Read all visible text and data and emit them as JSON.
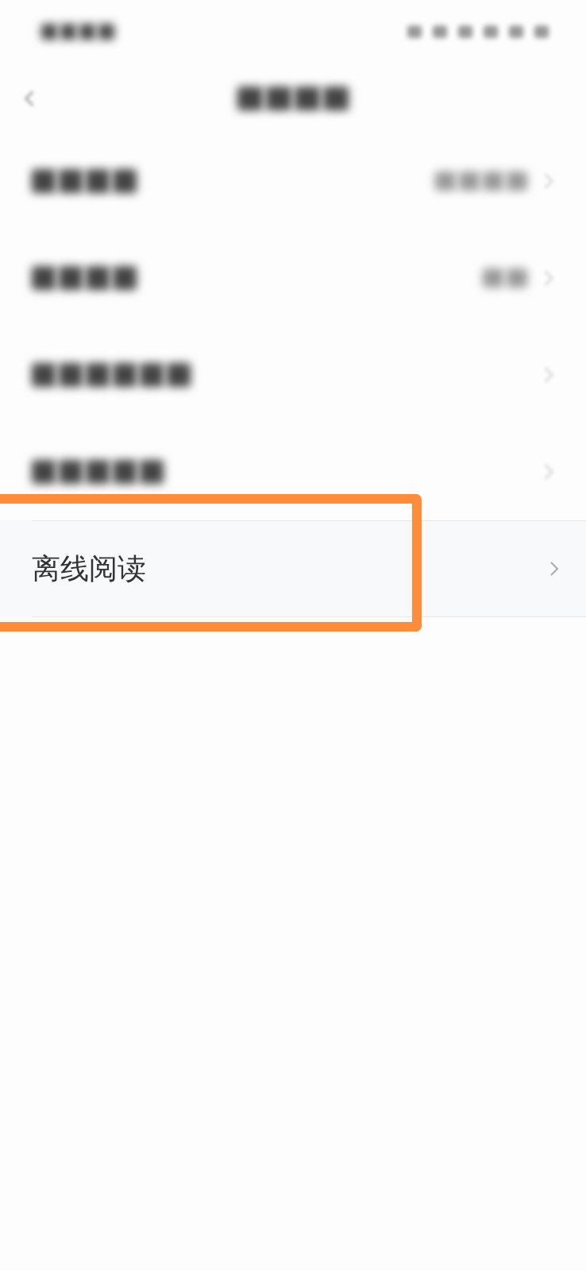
{
  "rows": [
    {
      "kind": "blurred",
      "detail": true,
      "highlighted": false
    },
    {
      "kind": "blurred",
      "detail": true,
      "highlighted": false
    },
    {
      "kind": "blurred",
      "detail": false,
      "highlighted": false
    },
    {
      "kind": "blurred",
      "detail": false,
      "highlighted": false
    },
    {
      "kind": "plain",
      "label": "离线阅读",
      "highlighted": true
    }
  ]
}
